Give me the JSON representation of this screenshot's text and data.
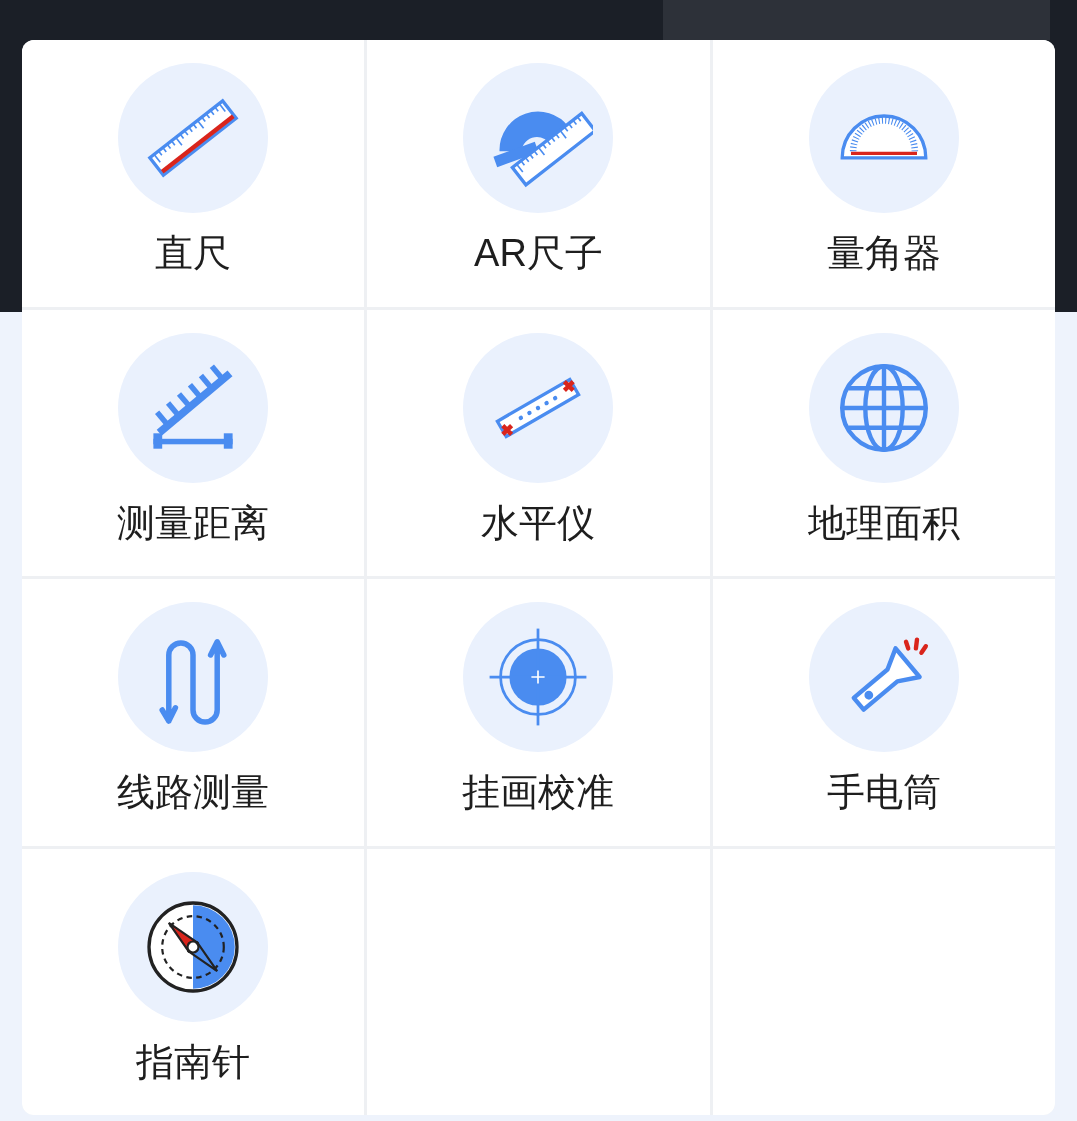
{
  "tools": [
    {
      "label": "直尺"
    },
    {
      "label": "AR尺子"
    },
    {
      "label": "量角器"
    },
    {
      "label": "测量距离"
    },
    {
      "label": "水平仪"
    },
    {
      "label": "地理面积"
    },
    {
      "label": "线路测量"
    },
    {
      "label": "挂画校准"
    },
    {
      "label": "手电筒"
    },
    {
      "label": "指南针"
    }
  ]
}
